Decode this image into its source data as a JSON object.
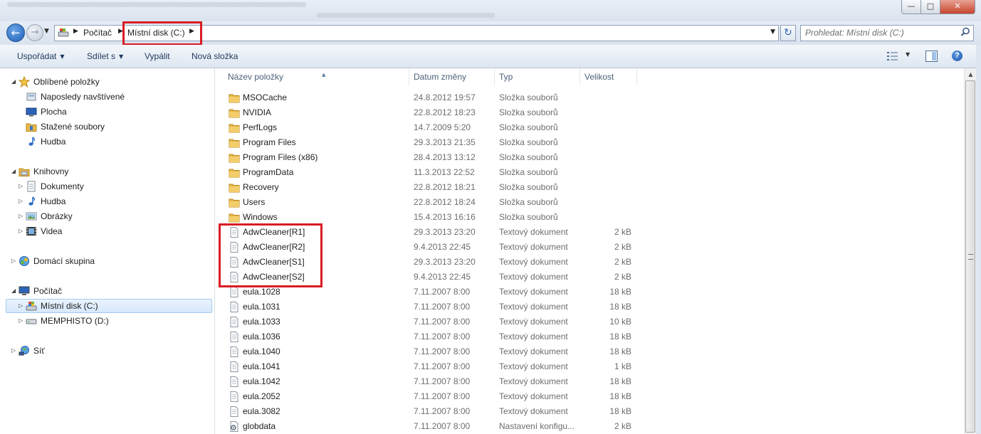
{
  "window": {
    "minimize_glyph": "—",
    "maximize_glyph": "□",
    "close_glyph": "✕"
  },
  "nav": {
    "back_glyph": "←",
    "forward_glyph": "→",
    "history_glyph": "▼",
    "address_icon": "computer-drive-icon",
    "breadcrumb": [
      "Počítač",
      "Místní disk (C:)"
    ],
    "separator_glyph": "▶",
    "dropdown_glyph": "▼",
    "refresh_glyph": "↻",
    "search_placeholder": "Prohledat: Místní disk (C:)"
  },
  "toolbar": {
    "organize": "Uspořádat",
    "share": "Sdílet s",
    "burn": "Vypálit",
    "new_folder": "Nová složka",
    "arrow_glyph": "▼",
    "help_glyph": "?"
  },
  "sidebar": {
    "favorites": {
      "label": "Oblíbené položky",
      "items": [
        "Naposledy navštívené",
        "Plocha",
        "Stažené soubory",
        "Hudba"
      ]
    },
    "libraries": {
      "label": "Knihovny",
      "items": [
        "Dokumenty",
        "Hudba",
        "Obrázky",
        "Videa"
      ]
    },
    "homegroup": {
      "label": "Domácí skupina"
    },
    "computer": {
      "label": "Počítač",
      "items": [
        "Místní disk (C:)",
        "MEMPHISTO (D:)"
      ],
      "selected": "Místní disk (C:)"
    },
    "network": {
      "label": "Síť"
    },
    "expanded_glyph": "◢",
    "collapsed_glyph": "▷"
  },
  "columns": {
    "name": "Název položky",
    "date": "Datum změny",
    "type": "Typ",
    "size": "Velikost",
    "sort_glyph": "▲"
  },
  "files": [
    {
      "name": "MSOCache",
      "date": "24.8.2012 19:57",
      "type": "Složka souborů",
      "size": "",
      "kind": "folder"
    },
    {
      "name": "NVIDIA",
      "date": "22.8.2012 18:23",
      "type": "Složka souborů",
      "size": "",
      "kind": "folder"
    },
    {
      "name": "PerfLogs",
      "date": "14.7.2009 5:20",
      "type": "Složka souborů",
      "size": "",
      "kind": "folder"
    },
    {
      "name": "Program Files",
      "date": "29.3.2013 21:35",
      "type": "Složka souborů",
      "size": "",
      "kind": "folder"
    },
    {
      "name": "Program Files (x86)",
      "date": "28.4.2013 13:12",
      "type": "Složka souborů",
      "size": "",
      "kind": "folder"
    },
    {
      "name": "ProgramData",
      "date": "11.3.2013 22:52",
      "type": "Složka souborů",
      "size": "",
      "kind": "folder"
    },
    {
      "name": "Recovery",
      "date": "22.8.2012 18:21",
      "type": "Složka souborů",
      "size": "",
      "kind": "folder"
    },
    {
      "name": "Users",
      "date": "22.8.2012 18:24",
      "type": "Složka souborů",
      "size": "",
      "kind": "folder"
    },
    {
      "name": "Windows",
      "date": "15.4.2013 16:16",
      "type": "Složka souborů",
      "size": "",
      "kind": "folder"
    },
    {
      "name": "AdwCleaner[R1]",
      "date": "29.3.2013 23:20",
      "type": "Textový dokument",
      "size": "2 kB",
      "kind": "text"
    },
    {
      "name": "AdwCleaner[R2]",
      "date": "9.4.2013 22:45",
      "type": "Textový dokument",
      "size": "2 kB",
      "kind": "text"
    },
    {
      "name": "AdwCleaner[S1]",
      "date": "29.3.2013 23:20",
      "type": "Textový dokument",
      "size": "2 kB",
      "kind": "text"
    },
    {
      "name": "AdwCleaner[S2]",
      "date": "9.4.2013 22:45",
      "type": "Textový dokument",
      "size": "2 kB",
      "kind": "text"
    },
    {
      "name": "eula.1028",
      "date": "7.11.2007 8:00",
      "type": "Textový dokument",
      "size": "18 kB",
      "kind": "text"
    },
    {
      "name": "eula.1031",
      "date": "7.11.2007 8:00",
      "type": "Textový dokument",
      "size": "18 kB",
      "kind": "text"
    },
    {
      "name": "eula.1033",
      "date": "7.11.2007 8:00",
      "type": "Textový dokument",
      "size": "10 kB",
      "kind": "text"
    },
    {
      "name": "eula.1036",
      "date": "7.11.2007 8:00",
      "type": "Textový dokument",
      "size": "18 kB",
      "kind": "text"
    },
    {
      "name": "eula.1040",
      "date": "7.11.2007 8:00",
      "type": "Textový dokument",
      "size": "18 kB",
      "kind": "text"
    },
    {
      "name": "eula.1041",
      "date": "7.11.2007 8:00",
      "type": "Textový dokument",
      "size": "1 kB",
      "kind": "text"
    },
    {
      "name": "eula.1042",
      "date": "7.11.2007 8:00",
      "type": "Textový dokument",
      "size": "18 kB",
      "kind": "text"
    },
    {
      "name": "eula.2052",
      "date": "7.11.2007 8:00",
      "type": "Textový dokument",
      "size": "18 kB",
      "kind": "text"
    },
    {
      "name": "eula.3082",
      "date": "7.11.2007 8:00",
      "type": "Textový dokument",
      "size": "18 kB",
      "kind": "text"
    },
    {
      "name": "globdata",
      "date": "7.11.2007 8:00",
      "type": "Nastavení konfigu...",
      "size": "2 kB",
      "kind": "config"
    }
  ],
  "scrollbar": {
    "up_glyph": "▲"
  },
  "colors": {
    "highlight_box": "#d91c24",
    "folder": "#e8b84a",
    "selection": "#d6e8fc"
  }
}
